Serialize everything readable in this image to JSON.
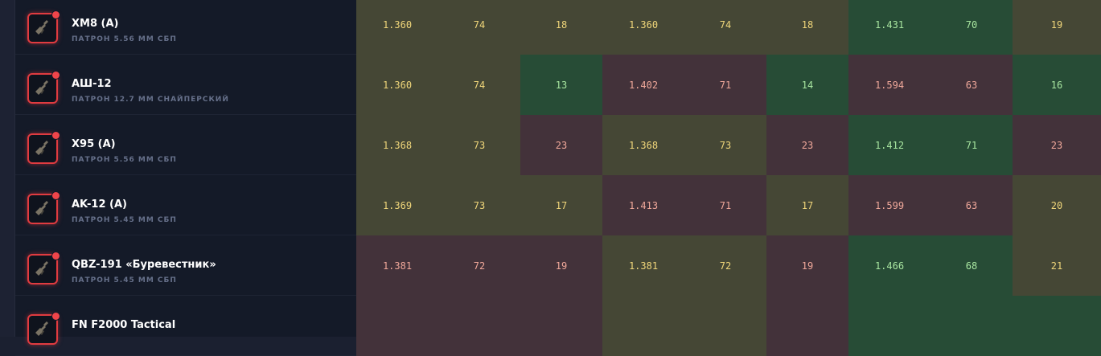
{
  "colors": {
    "neutral_bg": "#454735",
    "neutral_text": "#f0d67a",
    "good_bg": "#274c36",
    "good_text": "#a8e6a0",
    "bad_bg": "#43323a",
    "bad_text": "#f0a89a",
    "accent": "#e03b40"
  },
  "weapons": [
    {
      "name": "XM8 (A)",
      "ammo": "ПАТРОН 5.56 ММ СБП",
      "icon": "rifle-icon",
      "cells": [
        {
          "v": "1.360",
          "s": "neutral"
        },
        {
          "v": "74",
          "s": "neutral"
        },
        {
          "v": "18",
          "s": "neutral"
        },
        {
          "v": "1.360",
          "s": "neutral"
        },
        {
          "v": "74",
          "s": "neutral"
        },
        {
          "v": "18",
          "s": "neutral"
        },
        {
          "v": "1.431",
          "s": "good"
        },
        {
          "v": "70",
          "s": "good"
        },
        {
          "v": "19",
          "s": "neutral"
        }
      ]
    },
    {
      "name": "АШ-12",
      "ammo": "ПАТРОН 12.7 ММ СНАЙПЕРСКИЙ",
      "icon": "rifle-icon",
      "cells": [
        {
          "v": "1.360",
          "s": "neutral"
        },
        {
          "v": "74",
          "s": "neutral"
        },
        {
          "v": "13",
          "s": "good"
        },
        {
          "v": "1.402",
          "s": "bad"
        },
        {
          "v": "71",
          "s": "bad"
        },
        {
          "v": "14",
          "s": "good"
        },
        {
          "v": "1.594",
          "s": "bad"
        },
        {
          "v": "63",
          "s": "bad"
        },
        {
          "v": "16",
          "s": "good"
        }
      ]
    },
    {
      "name": "X95 (A)",
      "ammo": "ПАТРОН 5.56 ММ СБП",
      "icon": "rifle-icon",
      "cells": [
        {
          "v": "1.368",
          "s": "neutral"
        },
        {
          "v": "73",
          "s": "neutral"
        },
        {
          "v": "23",
          "s": "bad"
        },
        {
          "v": "1.368",
          "s": "neutral"
        },
        {
          "v": "73",
          "s": "neutral"
        },
        {
          "v": "23",
          "s": "bad"
        },
        {
          "v": "1.412",
          "s": "good"
        },
        {
          "v": "71",
          "s": "good"
        },
        {
          "v": "23",
          "s": "bad"
        }
      ]
    },
    {
      "name": "AK-12 (A)",
      "ammo": "ПАТРОН 5.45 ММ СБП",
      "icon": "rifle-icon",
      "cells": [
        {
          "v": "1.369",
          "s": "neutral"
        },
        {
          "v": "73",
          "s": "neutral"
        },
        {
          "v": "17",
          "s": "neutral"
        },
        {
          "v": "1.413",
          "s": "bad"
        },
        {
          "v": "71",
          "s": "bad"
        },
        {
          "v": "17",
          "s": "neutral"
        },
        {
          "v": "1.599",
          "s": "bad"
        },
        {
          "v": "63",
          "s": "bad"
        },
        {
          "v": "20",
          "s": "neutral"
        }
      ]
    },
    {
      "name": "QBZ-191 «Буревестник»",
      "ammo": "ПАТРОН 5.45 ММ СБП",
      "icon": "rifle-icon",
      "cells": [
        {
          "v": "1.381",
          "s": "bad"
        },
        {
          "v": "72",
          "s": "bad"
        },
        {
          "v": "19",
          "s": "bad"
        },
        {
          "v": "1.381",
          "s": "neutral"
        },
        {
          "v": "72",
          "s": "neutral"
        },
        {
          "v": "19",
          "s": "bad"
        },
        {
          "v": "1.466",
          "s": "good"
        },
        {
          "v": "68",
          "s": "good"
        },
        {
          "v": "21",
          "s": "neutral"
        }
      ]
    },
    {
      "name": "FN F2000 Tactical",
      "ammo": "",
      "icon": "rifle-icon",
      "cells": [
        {
          "v": "",
          "s": "bad"
        },
        {
          "v": "",
          "s": "bad"
        },
        {
          "v": "",
          "s": "bad"
        },
        {
          "v": "",
          "s": "neutral"
        },
        {
          "v": "",
          "s": "neutral"
        },
        {
          "v": "",
          "s": "bad"
        },
        {
          "v": "",
          "s": "good"
        },
        {
          "v": "",
          "s": "good"
        },
        {
          "v": "",
          "s": "good"
        }
      ]
    }
  ]
}
